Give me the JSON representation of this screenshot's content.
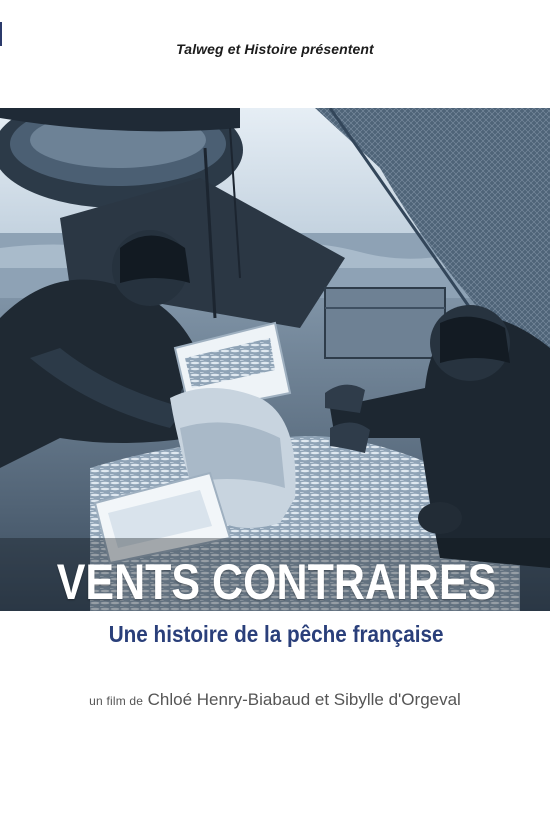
{
  "poster": {
    "presents": "Talweg et Histoire présentent",
    "title": "VENTS CONTRAIRES",
    "subtitle": "Une histoire de la pêche française",
    "credit_prefix": "un film de",
    "directors": "Chloé Henry-Biabaud et Sibylle d'Orgeval"
  },
  "colors": {
    "subtitle": "#2a3f7a",
    "title": "#ffffff",
    "photo_tone": "#5c7288"
  }
}
